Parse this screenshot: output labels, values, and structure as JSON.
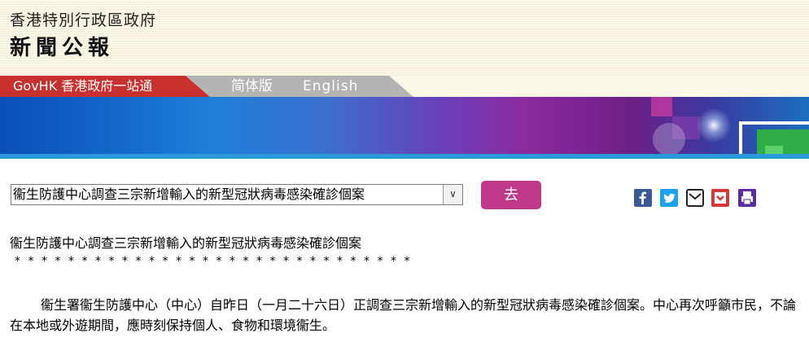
{
  "header": {
    "gov_name": "香港特別行政區政府",
    "press_title": "新聞公報"
  },
  "tabs": {
    "govhk": "GovHK 香港政府一站通",
    "simplified": "简体版",
    "english": "English"
  },
  "selector": {
    "selected": "衞生防護中心調查三宗新增輸入的新型冠狀病毒感染確診個案",
    "go_label": "去"
  },
  "share_icons": [
    "facebook-icon",
    "twitter-icon",
    "email-icon",
    "save-icon",
    "print-icon"
  ],
  "article": {
    "headline": "衞生防護中心調查三宗新增輸入的新型冠狀病毒感染確診個案",
    "separator": "******************************",
    "paragraph": "衞生署衞生防護中心（中心）自昨日（一月二十六日）正調查三宗新增輸入的新型冠狀病毒感染確診個案。中心再次呼籲市民，不論在本地或外遊期間，應時刻保持個人、食物和環境衞生。"
  },
  "colors": {
    "header_bg": "#fbf8e8",
    "govhk_tab": "#c8302f",
    "lang_tab": "#b4b4b4",
    "go_button": "#c03888",
    "facebook": "#3b5998",
    "twitter": "#1da1f2",
    "save": "#d23a3a",
    "print": "#5b2ca0"
  }
}
